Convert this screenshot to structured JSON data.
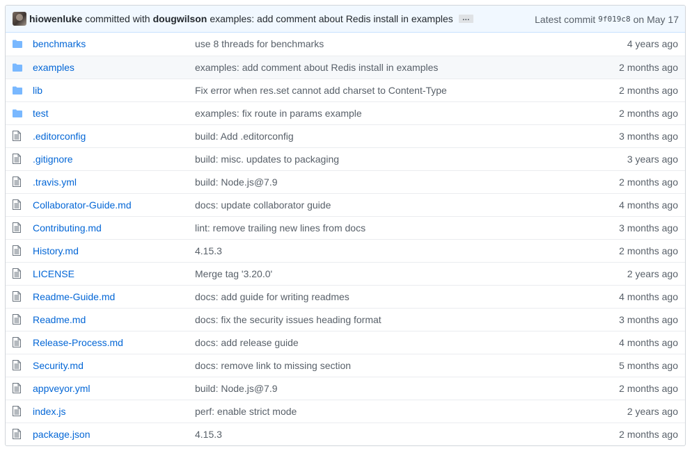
{
  "commit": {
    "author": "hiowenluke",
    "committed_with": "committed with",
    "committer": "dougwilson",
    "message": "examples: add comment about Redis install in examples",
    "ellipsis": "…",
    "latest_label": "Latest commit",
    "sha": "9f019c8",
    "date": "on May 17"
  },
  "files": [
    {
      "name": "benchmarks",
      "type": "directory",
      "message": "use 8 threads for benchmarks",
      "age": "4 years ago"
    },
    {
      "name": "examples",
      "type": "directory",
      "message": "examples: add comment about Redis install in examples",
      "age": "2 months ago"
    },
    {
      "name": "lib",
      "type": "directory",
      "message": "Fix error when res.set cannot add charset to Content-Type",
      "age": "2 months ago"
    },
    {
      "name": "test",
      "type": "directory",
      "message": "examples: fix route in params example",
      "age": "2 months ago"
    },
    {
      "name": ".editorconfig",
      "type": "file",
      "message": "build: Add .editorconfig",
      "age": "3 months ago"
    },
    {
      "name": ".gitignore",
      "type": "file",
      "message": "build: misc. updates to packaging",
      "age": "3 years ago"
    },
    {
      "name": ".travis.yml",
      "type": "file",
      "message": "build: Node.js@7.9",
      "age": "2 months ago"
    },
    {
      "name": "Collaborator-Guide.md",
      "type": "file",
      "message": "docs: update collaborator guide",
      "age": "4 months ago"
    },
    {
      "name": "Contributing.md",
      "type": "file",
      "message": "lint: remove trailing new lines from docs",
      "age": "3 months ago"
    },
    {
      "name": "History.md",
      "type": "file",
      "message": "4.15.3",
      "age": "2 months ago"
    },
    {
      "name": "LICENSE",
      "type": "file",
      "message": "Merge tag '3.20.0'",
      "age": "2 years ago"
    },
    {
      "name": "Readme-Guide.md",
      "type": "file",
      "message": "docs: add guide for writing readmes",
      "age": "4 months ago"
    },
    {
      "name": "Readme.md",
      "type": "file",
      "message": "docs: fix the security issues heading format",
      "age": "3 months ago"
    },
    {
      "name": "Release-Process.md",
      "type": "file",
      "message": "docs: add release guide",
      "age": "4 months ago"
    },
    {
      "name": "Security.md",
      "type": "file",
      "message": "docs: remove link to missing section",
      "age": "5 months ago"
    },
    {
      "name": "appveyor.yml",
      "type": "file",
      "message": "build: Node.js@7.9",
      "age": "2 months ago"
    },
    {
      "name": "index.js",
      "type": "file",
      "message": "perf: enable strict mode",
      "age": "2 years ago"
    },
    {
      "name": "package.json",
      "type": "file",
      "message": "4.15.3",
      "age": "2 months ago"
    }
  ],
  "hovered_row": 1,
  "colors": {
    "link": "#0366d6",
    "muted": "#586069",
    "folder_icon": "#79b8ff",
    "file_icon": "#6a737d",
    "commit_bar_bg": "#f1f8ff"
  }
}
